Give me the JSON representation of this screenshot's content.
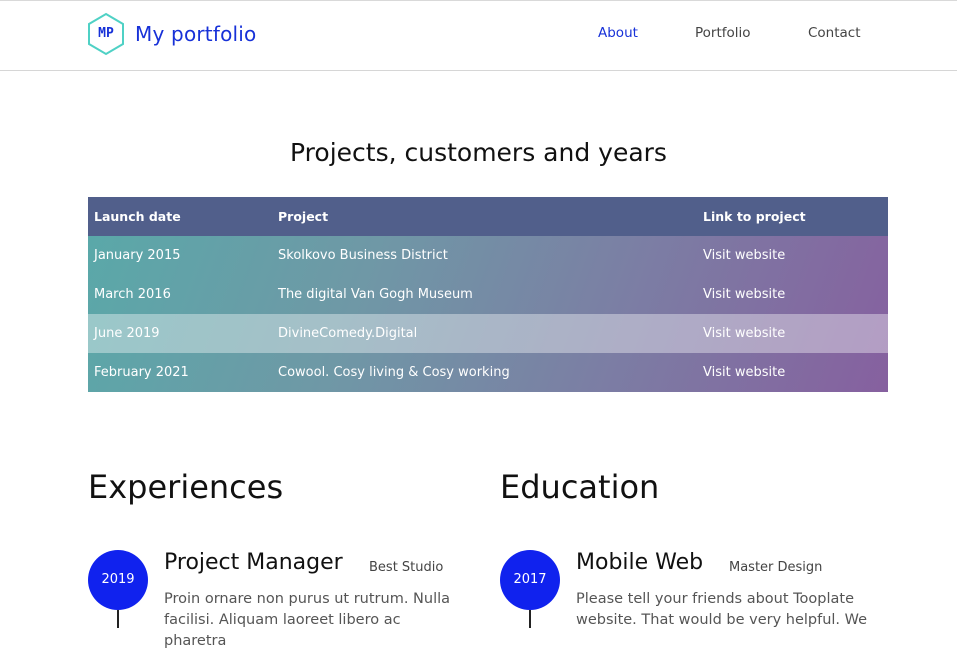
{
  "header": {
    "logo_text": "MP",
    "brand": "My portfolio",
    "nav": [
      {
        "label": "About",
        "active": true
      },
      {
        "label": "Portfolio",
        "active": false
      },
      {
        "label": "Contact",
        "active": false
      }
    ]
  },
  "projects": {
    "title": "Projects, customers and years",
    "columns": [
      "Launch date",
      "Project",
      "Link to project"
    ],
    "rows": [
      {
        "date": "January 2015",
        "project": "Skolkovo Business District",
        "link": "Visit website"
      },
      {
        "date": "March 2016",
        "project": "The digital Van Gogh Museum",
        "link": "Visit website"
      },
      {
        "date": "June 2019",
        "project": "DivineComedy.Digital",
        "link": "Visit website"
      },
      {
        "date": "February 2021",
        "project": "Cowool. Cosy living & Cosy working",
        "link": "Visit website"
      }
    ]
  },
  "experiences": {
    "title": "Experiences",
    "items": [
      {
        "year": "2019",
        "role": "Project Manager",
        "org": "Best Studio",
        "text": "Proin ornare non purus ut rutrum. Nulla facilisi. Aliquam laoreet libero ac pharetra"
      }
    ]
  },
  "education": {
    "title": "Education",
    "items": [
      {
        "year": "2017",
        "role": "Mobile Web",
        "org": "Master Design",
        "text": "Please tell your friends about Tooplate website. That would be very helpful. We"
      }
    ]
  },
  "colors": {
    "accent": "#1022ee",
    "brand": "#1731d8",
    "table_header": "#515f8b",
    "logo_stroke": "#4fd1c5"
  }
}
